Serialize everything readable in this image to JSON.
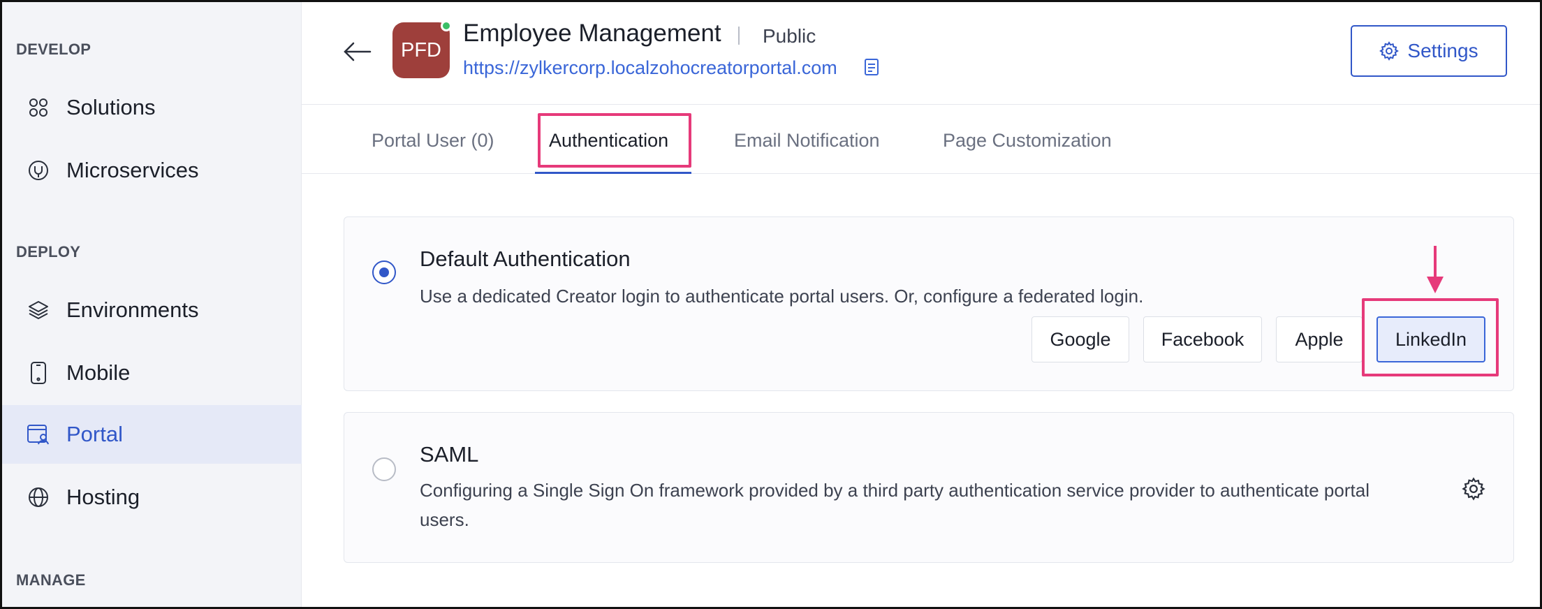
{
  "sidebar": {
    "sections": [
      {
        "title": "DEVELOP"
      },
      {
        "title": "DEPLOY"
      },
      {
        "title": "MANAGE"
      }
    ],
    "items": [
      {
        "label": "Solutions",
        "icon": "solutions-icon"
      },
      {
        "label": "Microservices",
        "icon": "microservices-icon"
      },
      {
        "label": "Environments",
        "icon": "layers-icon"
      },
      {
        "label": "Mobile",
        "icon": "mobile-icon"
      },
      {
        "label": "Portal",
        "icon": "portal-icon",
        "active": true
      },
      {
        "label": "Hosting",
        "icon": "globe-icon"
      }
    ]
  },
  "header": {
    "avatar_text": "PFD",
    "app_title": "Employee Management",
    "visibility": "Public",
    "portal_url": "https://zylkercorp.localzohocreatorportal.com",
    "settings_label": "Settings"
  },
  "tabs": [
    {
      "label": "Portal User (0)"
    },
    {
      "label": "Authentication",
      "active": true
    },
    {
      "label": "Email Notification"
    },
    {
      "label": "Page Customization"
    }
  ],
  "auth": {
    "default": {
      "title": "Default Authentication",
      "description": "Use a dedicated Creator login to authenticate portal users. Or, configure a federated login.",
      "selected": true,
      "providers": [
        {
          "label": "Google"
        },
        {
          "label": "Facebook"
        },
        {
          "label": "Apple"
        },
        {
          "label": "LinkedIn",
          "selected": true
        }
      ]
    },
    "saml": {
      "title": "SAML",
      "description_line1": "Configuring a Single Sign On framework provided by a third party authentication service provider to authenticate portal",
      "description_line2": "users.",
      "selected": false
    }
  },
  "colors": {
    "accent": "#3157c8",
    "highlight": "#e63a7a",
    "avatar_bg": "#9e3f3b",
    "online_dot": "#3bbf67"
  }
}
